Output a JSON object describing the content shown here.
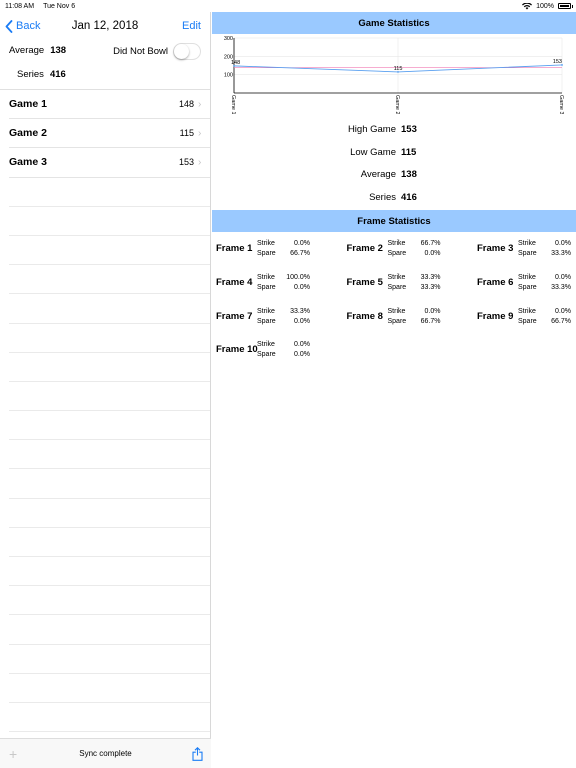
{
  "status": {
    "time": "11:08 AM",
    "date": "Tue Nov 6",
    "battery": "100%",
    "battery_level": 1.0
  },
  "nav": {
    "back_label": "Back",
    "title": "Jan 12, 2018",
    "edit_label": "Edit"
  },
  "summary": {
    "average_label": "Average",
    "average_value": "138",
    "series_label": "Series",
    "series_value": "416",
    "did_not_bowl_label": "Did Not Bowl",
    "did_not_bowl_on": false
  },
  "games": [
    {
      "label": "Game 1",
      "score": "148"
    },
    {
      "label": "Game 2",
      "score": "115"
    },
    {
      "label": "Game 3",
      "score": "153"
    }
  ],
  "toolbar": {
    "sync_text": "Sync complete"
  },
  "game_stats_title": "Game Statistics",
  "chart_data": {
    "type": "line",
    "categories": [
      "Game 1",
      "Game 2",
      "Game 3"
    ],
    "series": [
      {
        "values": [
          148,
          115,
          153
        ],
        "color": "#5aa0f0"
      }
    ],
    "reference_line": {
      "value": 138,
      "color": "#f07ab4"
    },
    "yticks": [
      "300",
      "200",
      "100"
    ],
    "ylim": [
      0,
      300
    ],
    "grid": true
  },
  "stats": [
    {
      "label": "High Game",
      "value": "153"
    },
    {
      "label": "Low Game",
      "value": "115"
    },
    {
      "label": "Average",
      "value": "138"
    },
    {
      "label": "Series",
      "value": "416"
    }
  ],
  "frame_stats_title": "Frame Statistics",
  "frame_labels": {
    "strike": "Strike",
    "spare": "Spare"
  },
  "frames": [
    {
      "name": "Frame 1",
      "strike": "0.0%",
      "spare": "66.7%"
    },
    {
      "name": "Frame 2",
      "strike": "66.7%",
      "spare": "0.0%"
    },
    {
      "name": "Frame 3",
      "strike": "0.0%",
      "spare": "33.3%"
    },
    {
      "name": "Frame 4",
      "strike": "100.0%",
      "spare": "0.0%"
    },
    {
      "name": "Frame 5",
      "strike": "33.3%",
      "spare": "33.3%"
    },
    {
      "name": "Frame 6",
      "strike": "0.0%",
      "spare": "33.3%"
    },
    {
      "name": "Frame 7",
      "strike": "33.3%",
      "spare": "0.0%"
    },
    {
      "name": "Frame 8",
      "strike": "0.0%",
      "spare": "66.7%"
    },
    {
      "name": "Frame 9",
      "strike": "0.0%",
      "spare": "66.7%"
    },
    {
      "name": "Frame 10",
      "strike": "0.0%",
      "spare": "0.0%"
    }
  ]
}
